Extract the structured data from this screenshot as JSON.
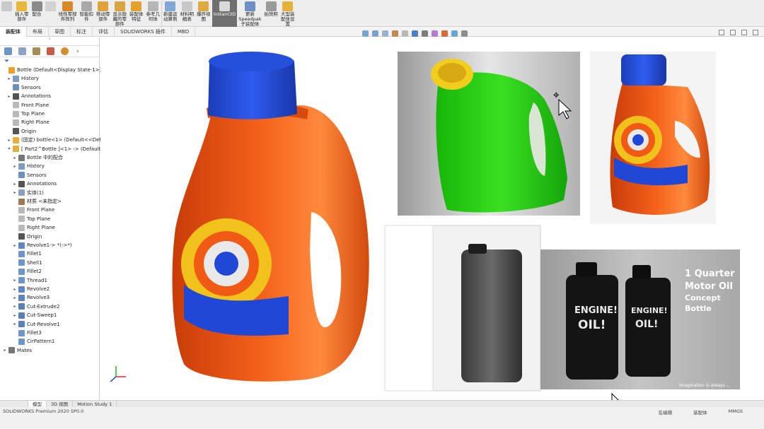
{
  "ribbon": {
    "buttons": [
      {
        "label": "",
        "icon": "gear-icon"
      },
      {
        "label": "插入零\n部件",
        "icon": "insert-component-icon"
      },
      {
        "label": "配合",
        "icon": "mate-icon"
      },
      {
        "label": "",
        "icon": "component-preview-icon"
      },
      {
        "label": "线性零部\n件阵列",
        "icon": "linear-pattern-icon"
      },
      {
        "label": "智能扣\n件",
        "icon": "smart-fastener-icon"
      },
      {
        "label": "移动零\n部件",
        "icon": "move-component-icon"
      },
      {
        "label": "显示隐\n藏的零\n部件",
        "icon": "show-hidden-icon"
      },
      {
        "label": "装配体\n特征",
        "icon": "assembly-feature-icon"
      },
      {
        "label": "参考几\n何体",
        "icon": "reference-geometry-icon"
      },
      {
        "label": "新建运\n动算例",
        "icon": "motion-study-icon"
      },
      {
        "label": "材料明\n细表",
        "icon": "bom-icon"
      },
      {
        "label": "爆炸视\n图",
        "icon": "exploded-view-icon"
      },
      {
        "label": "Instant3D",
        "icon": "instant3d-icon"
      },
      {
        "label": "更新\nSpeedpak\n子装配体",
        "icon": "speedpak-icon"
      },
      {
        "label": "拍快照",
        "icon": "snapshot-icon"
      },
      {
        "label": "大型装\n配体设\n置",
        "icon": "large-assembly-icon"
      }
    ]
  },
  "tabs": [
    "装配体",
    "布局",
    "草图",
    "标注",
    "评估",
    "SOLIDWORKS 插件",
    "MBD"
  ],
  "feature_tree": {
    "items": [
      {
        "label": "Bottle  (Default<Display State-1>)",
        "icon": "assembly-icon",
        "arrow": ""
      },
      {
        "label": "History",
        "icon": "history-icon",
        "arrow": "▸"
      },
      {
        "label": "Sensors",
        "icon": "sensors-icon",
        "arrow": ""
      },
      {
        "label": "Annotations",
        "icon": "annotations-icon",
        "arrow": "▸"
      },
      {
        "label": "Front Plane",
        "icon": "plane-icon",
        "arrow": ""
      },
      {
        "label": "Top Plane",
        "icon": "plane-icon",
        "arrow": ""
      },
      {
        "label": "Right Plane",
        "icon": "plane-icon",
        "arrow": ""
      },
      {
        "label": "Origin",
        "icon": "origin-icon",
        "arrow": ""
      },
      {
        "label": "(固定) bottle<1> (Default<<Defa",
        "icon": "part-icon",
        "arrow": "▸"
      },
      {
        "label": "[ Part2^Bottle ]<1> ->  (Default<",
        "icon": "part-icon",
        "arrow": "▾"
      },
      {
        "label": "Bottle 中的配合",
        "icon": "mates-icon",
        "arrow": "▸"
      },
      {
        "label": "History",
        "icon": "history-icon",
        "arrow": "▸"
      },
      {
        "label": "Sensors",
        "icon": "sensors-icon",
        "arrow": ""
      },
      {
        "label": "Annotations",
        "icon": "annotations-icon",
        "arrow": "▸"
      },
      {
        "label": "实体(1)",
        "icon": "solid-bodies-icon",
        "arrow": "▸"
      },
      {
        "label": "材质 <未指定>",
        "icon": "material-icon",
        "arrow": ""
      },
      {
        "label": "Front Plane",
        "icon": "plane-icon",
        "arrow": ""
      },
      {
        "label": "Top Plane",
        "icon": "plane-icon",
        "arrow": ""
      },
      {
        "label": "Right Plane",
        "icon": "plane-icon",
        "arrow": ""
      },
      {
        "label": "Origin",
        "icon": "origin-icon",
        "arrow": ""
      },
      {
        "label": "Revolve1-> *(->*)",
        "icon": "revolve-icon",
        "arrow": "▸"
      },
      {
        "label": "Fillet1",
        "icon": "fillet-icon",
        "arrow": ""
      },
      {
        "label": "Shell1",
        "icon": "shell-icon",
        "arrow": ""
      },
      {
        "label": "Fillet2",
        "icon": "fillet-icon",
        "arrow": ""
      },
      {
        "label": "Thread1",
        "icon": "thread-icon",
        "arrow": "▸"
      },
      {
        "label": "Revolve2",
        "icon": "revolve-icon",
        "arrow": "▸"
      },
      {
        "label": "Revolve3",
        "icon": "revolve-icon",
        "arrow": "▸"
      },
      {
        "label": "Cut-Extrude2",
        "icon": "cut-extrude-icon",
        "arrow": "▸"
      },
      {
        "label": "Cut-Sweep1",
        "icon": "cut-sweep-icon",
        "arrow": "▸"
      },
      {
        "label": "Cut-Revolve1",
        "icon": "cut-revolve-icon",
        "arrow": "▸"
      },
      {
        "label": "Fillet3",
        "icon": "fillet-icon",
        "arrow": ""
      },
      {
        "label": "CirPattern1",
        "icon": "pattern-icon",
        "arrow": ""
      },
      {
        "label": "Mates",
        "icon": "mates-icon",
        "arrow": "▸"
      }
    ]
  },
  "images": {
    "poster_title": "1 Quarter\nMotor Oil\nConcept\nBottle",
    "poster_label_1": "ENGINE!\nOIL!",
    "poster_label_2": "ENGINE!\nOIL!",
    "poster_tagline": "Imagination is always ..."
  },
  "bottom_tabs": [
    "",
    "模型",
    "3D 视图",
    "Motion Study 1"
  ],
  "status": {
    "left": "SOLIDWORKS Premium 2020 SP0.0",
    "mid1": "在编辑",
    "mid2": "装配体",
    "right": "MMGS"
  },
  "colors": {
    "bottle_orange": "#f05a14",
    "cap_blue": "#1f48d6",
    "green_bottle": "#22d40e",
    "ring_yellow": "#f2c21c"
  }
}
